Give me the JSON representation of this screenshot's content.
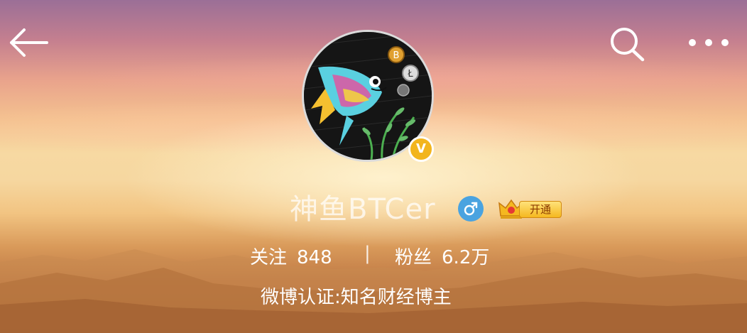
{
  "profile": {
    "username": "神鱼BTCer",
    "gender": "male",
    "verified_badge": "V",
    "vip_label": "开通",
    "following_label": "关注",
    "following_count": "848",
    "separator": "|",
    "followers_label": "粉丝",
    "followers_count": "6.2万",
    "verification": "微博认证:知名财经博主"
  },
  "icons": {
    "back": "back-arrow-icon",
    "search": "search-icon",
    "more": "more-dots-icon",
    "gender": "male-icon",
    "vip": "crown-icon"
  },
  "colors": {
    "verified_badge": "#f2b51d",
    "gender_icon": "#4aa3e0",
    "vip_badge": "#f5b820"
  }
}
